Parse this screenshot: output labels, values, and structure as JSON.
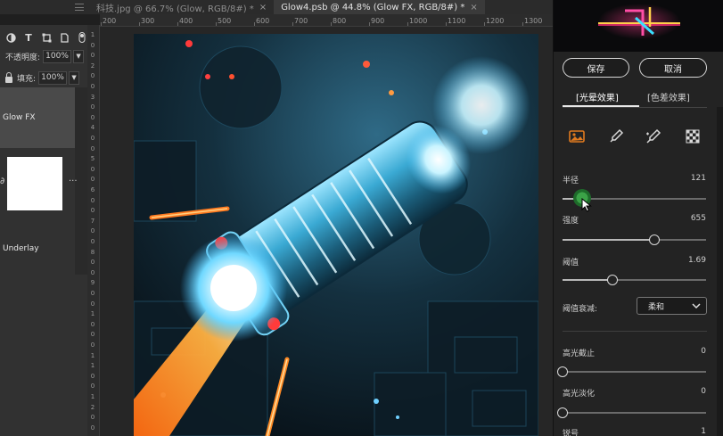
{
  "tabs": [
    {
      "label": "科技.jpg @ 66.7% (Glow, RGB/8#) *",
      "close": "×"
    },
    {
      "label": "Glow4.psb @ 44.8% (Glow FX, RGB/8#) *",
      "close": "×"
    }
  ],
  "layers_panel": {
    "opacity_label": "不透明度:",
    "opacity_value": "100%",
    "fill_label": "填充:",
    "fill_value": "100%",
    "layers": [
      "Glow FX",
      "Underlay"
    ],
    "more": "···"
  },
  "ruler": {
    "horizontal": [
      "200",
      "300",
      "400",
      "500",
      "600",
      "700",
      "800",
      "900",
      "1000",
      "1100",
      "1200",
      "1300"
    ],
    "vertical": [
      "1",
      "0",
      "0",
      "2",
      "0",
      "0",
      "3",
      "0",
      "0",
      "4",
      "0",
      "0",
      "5",
      "0",
      "0",
      "6",
      "0",
      "0",
      "7",
      "0",
      "0",
      "8",
      "0",
      "0",
      "9",
      "0",
      "0",
      "1",
      "0",
      "0",
      "0",
      "1",
      "1",
      "0",
      "0",
      "1",
      "2",
      "0",
      "0"
    ]
  },
  "glow_panel": {
    "save_label": "保存",
    "cancel_label": "取消",
    "tab_glow": "[光晕效果]",
    "tab_aberration": "[色差效果]",
    "sliders": [
      {
        "id": "radius",
        "label": "半径",
        "value": "121",
        "fraction": 0.15
      },
      {
        "id": "strength",
        "label": "强度",
        "value": "655",
        "fraction": 0.64
      },
      {
        "id": "threshold",
        "label": "阈值",
        "value": "1.69",
        "fraction": 0.35
      }
    ],
    "decay_label": "阈值衰减:",
    "decay_value": "柔和",
    "sliders2": [
      {
        "id": "highlight-cutoff",
        "label": "高光截止",
        "value": "0",
        "fraction": 0.0
      },
      {
        "id": "highlight-fade",
        "label": "高光淡化",
        "value": "0",
        "fraction": 0.0
      },
      {
        "id": "sharpen",
        "label": "锐号",
        "value": "1",
        "fraction": 0.0
      }
    ]
  },
  "colors": {
    "accent": "#e07a1f",
    "panel_bg": "#232323",
    "cursor": "#3ba247"
  },
  "icons": [
    "image-icon",
    "dropper-icon",
    "brush-dropper-icon",
    "checkerboard-icon"
  ]
}
